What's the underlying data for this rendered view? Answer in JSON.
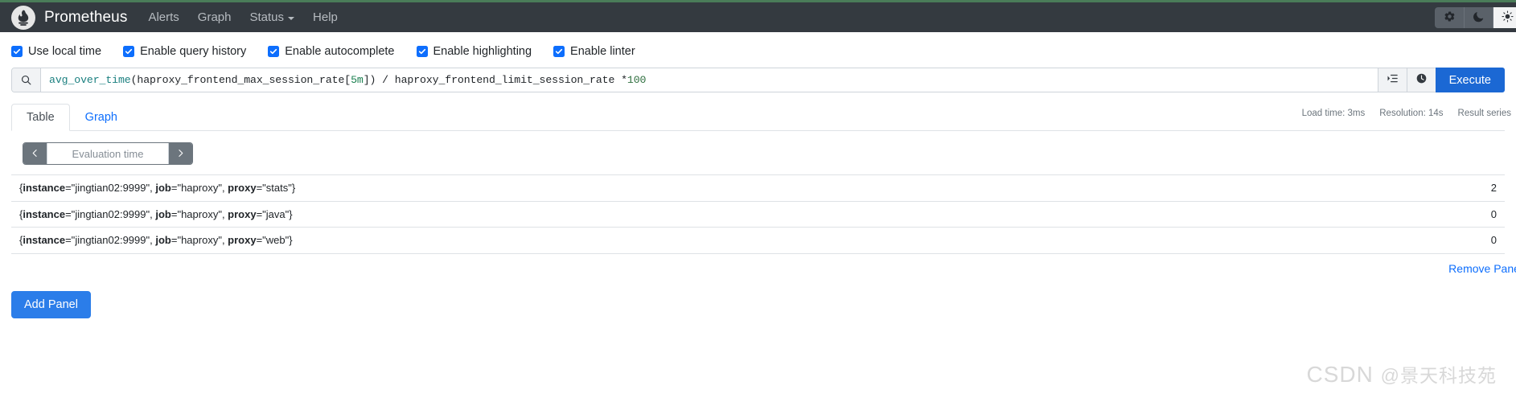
{
  "navbar": {
    "brand": "Prometheus",
    "logo_icon": "prometheus-torch-logo",
    "links": [
      {
        "label": "Alerts",
        "icon": ""
      },
      {
        "label": "Graph",
        "icon": ""
      },
      {
        "label": "Status",
        "icon": "chevron-down-icon",
        "has_caret": true
      },
      {
        "label": "Help",
        "icon": ""
      }
    ],
    "theme_buttons": [
      {
        "name": "gear-icon",
        "label": "Use system theme",
        "active": false
      },
      {
        "name": "moon-icon",
        "label": "Use dark theme",
        "active": false
      },
      {
        "name": "sun-icon",
        "label": "Use light theme",
        "active": true
      }
    ]
  },
  "options": [
    {
      "label": "Use local time",
      "checked": true
    },
    {
      "label": "Enable query history",
      "checked": true
    },
    {
      "label": "Enable autocomplete",
      "checked": true
    },
    {
      "label": "Enable highlighting",
      "checked": true
    },
    {
      "label": "Enable linter",
      "checked": true
    }
  ],
  "query": {
    "search_icon": "search-icon",
    "expression": "avg_over_time(haproxy_frontend_max_session_rate[5m]) / haproxy_frontend_limit_session_rate * 100",
    "tokens": [
      {
        "text": "avg_over_time",
        "type": "function"
      },
      {
        "text": "(haproxy_frontend_max_session_rate[",
        "type": "plain"
      },
      {
        "text": "5m",
        "type": "duration"
      },
      {
        "text": "]) / haproxy_frontend_limit_session_rate * ",
        "type": "plain"
      },
      {
        "text": "100",
        "type": "number"
      }
    ],
    "metrics_explorer_icon": "metrics-explorer-icon",
    "query_history_icon": "query-history-icon",
    "execute_label": "Execute"
  },
  "tabs": [
    {
      "label": "Table",
      "active": true
    },
    {
      "label": "Graph",
      "active": false
    }
  ],
  "stats": {
    "load_time": "Load time: 3ms",
    "resolution": "Resolution: 14s",
    "result_series": "Result series"
  },
  "evaluation": {
    "prev_icon": "chevron-left-icon",
    "next_icon": "chevron-right-icon",
    "placeholder": "Evaluation time",
    "value": ""
  },
  "results": {
    "rows": [
      {
        "labels": [
          {
            "name": "instance",
            "value": "jingtian02:9999"
          },
          {
            "name": "job",
            "value": "haproxy"
          },
          {
            "name": "proxy",
            "value": "stats"
          }
        ],
        "value": "2"
      },
      {
        "labels": [
          {
            "name": "instance",
            "value": "jingtian02:9999"
          },
          {
            "name": "job",
            "value": "haproxy"
          },
          {
            "name": "proxy",
            "value": "java"
          }
        ],
        "value": "0"
      },
      {
        "labels": [
          {
            "name": "instance",
            "value": "jingtian02:9999"
          },
          {
            "name": "job",
            "value": "haproxy"
          },
          {
            "name": "proxy",
            "value": "web"
          }
        ],
        "value": "0"
      }
    ]
  },
  "footer": {
    "remove_panel": "Remove Panel",
    "add_panel": "Add Panel"
  },
  "watermark": {
    "brand": "CSDN",
    "author": "@景天科技苑"
  },
  "colors": {
    "navbar_bg": "#343a40",
    "navbar_top_border": "#4a7c59",
    "accent_blue": "#0d6efd",
    "execute_blue": "#1b68d4",
    "add_panel_blue": "#2b7de9",
    "function_teal": "#1a7f7f",
    "duration_green": "#1a7f4f",
    "muted_gray": "#6c757d"
  }
}
